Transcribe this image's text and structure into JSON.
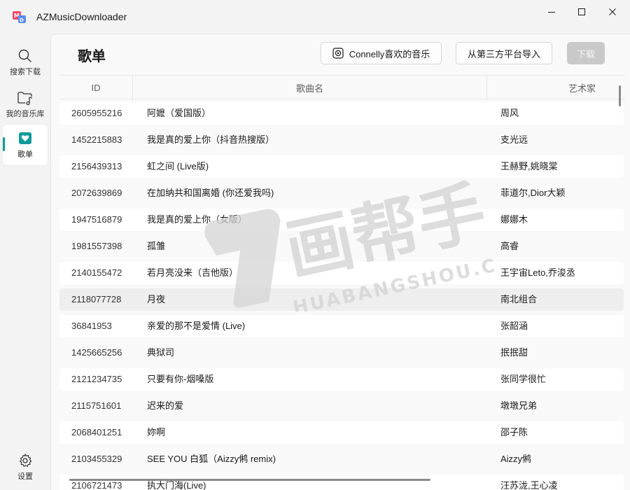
{
  "app": {
    "title": "AZMusicDownloader"
  },
  "window_controls": {
    "minimize_icon": "minimize-icon",
    "maximize_icon": "maximize-icon",
    "close_icon": "close-icon"
  },
  "sidebar": {
    "items": [
      {
        "label": "搜索下载",
        "icon": "search-icon"
      },
      {
        "label": "我的音乐库",
        "icon": "music-folder-icon"
      },
      {
        "label": "歌单",
        "icon": "heart-playlist-icon",
        "active": true
      },
      {
        "label": "设置",
        "icon": "gear-icon"
      }
    ]
  },
  "page": {
    "title": "歌单",
    "buttons": {
      "liked": "Connelly喜欢的音乐",
      "import": "从第三方平台导入",
      "download": "下载"
    }
  },
  "table": {
    "columns": [
      "ID",
      "歌曲名",
      "艺术家"
    ],
    "rows": [
      {
        "id": "2605955216",
        "song": "阿嬷（爱国版）",
        "artist": "周风"
      },
      {
        "id": "1452215883",
        "song": "我是真的爱上你（抖音热搜版）",
        "artist": "支光远"
      },
      {
        "id": "2156439313",
        "song": "虹之间 (Live版)",
        "artist": "王赫野,姚晓棠"
      },
      {
        "id": "2072639869",
        "song": "在加纳共和国离婚 (你还爱我吗)",
        "artist": "菲道尔,Dior大颖"
      },
      {
        "id": "1947516879",
        "song": "我是真的爱上你（女版）",
        "artist": "娜娜木"
      },
      {
        "id": "1981557398",
        "song": "孤雏",
        "artist": "高睿"
      },
      {
        "id": "2140155472",
        "song": "若月亮没来（吉他版）",
        "artist": "王宇宙Leto,乔浚丞"
      },
      {
        "id": "2118077728",
        "song": "月夜",
        "artist": "南北组合"
      },
      {
        "id": "36841953",
        "song": "亲爱的那不是爱情 (Live)",
        "artist": "张韶涵"
      },
      {
        "id": "1425665256",
        "song": "典狱司",
        "artist": "抿抿甜"
      },
      {
        "id": "2121234735",
        "song": "只要有你-烟嗓版",
        "artist": "张同学很忙"
      },
      {
        "id": "2115751601",
        "song": "迟来的爱",
        "artist": "墩墩兄弟"
      },
      {
        "id": "2068401251",
        "song": "妳啊",
        "artist": "邵子陈"
      },
      {
        "id": "2103455329",
        "song": "SEE YOU 白狐（Aizzy鸺 remix)",
        "artist": "Aizzy鸺"
      },
      {
        "id": "2106721473",
        "song": "执大门海(Live)",
        "artist": "汪苏泷,王心凌"
      }
    ]
  },
  "watermark": {
    "main": "画帮手",
    "sub": "HUABANGSHOU.COM"
  }
}
